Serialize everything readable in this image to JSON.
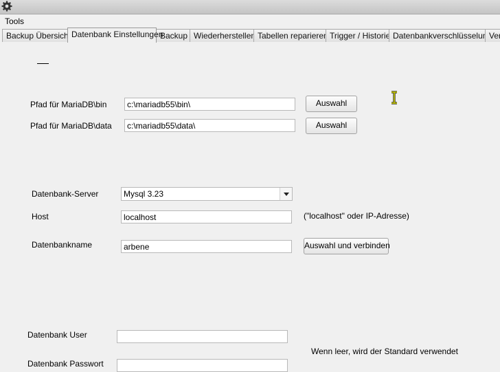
{
  "window": {
    "icon": "gear-icon"
  },
  "menubar": {
    "items": [
      {
        "label": "Tools"
      }
    ]
  },
  "tabs": [
    {
      "label": "Backup Übersicht"
    },
    {
      "label": "Datenbank Einstellungen",
      "active": true
    },
    {
      "label": "Backup"
    },
    {
      "label": "Wiederherstellen"
    },
    {
      "label": "Tabellen reparieren"
    },
    {
      "label": "Trigger / Historie"
    },
    {
      "label": "Datenbankverschlüsselung"
    },
    {
      "label": "Ver"
    }
  ],
  "settings": {
    "dash_text": "",
    "bin_path": {
      "label": "Pfad für MariaDB\\bin",
      "value": "c:\\mariadb55\\bin\\",
      "button": "Auswahl"
    },
    "data_path": {
      "label": "Pfad für MariaDB\\data",
      "value": "c:\\mariadb55\\data\\",
      "button": "Auswahl"
    },
    "server": {
      "label": "Datenbank-Server",
      "value": "Mysql 3.23"
    },
    "host": {
      "label": "Host",
      "value": "localhost",
      "hint": "(\"localhost\" oder IP-Adresse)"
    },
    "dbname": {
      "label": "Datenbankname",
      "value": "arbene",
      "button": "Auswahl und verbinden"
    },
    "user": {
      "label": "Datenbank User",
      "value": ""
    },
    "password": {
      "label": "Datenbank Passwort",
      "value": ""
    },
    "default_hint": "Wenn leer, wird der Standard verwendet"
  },
  "colors": {
    "background": "#f0f0f0",
    "tab_border": "#a8a8a8",
    "cursor": "#c8c800"
  },
  "icons": {
    "text_cursor": "text-cursor-icon"
  }
}
